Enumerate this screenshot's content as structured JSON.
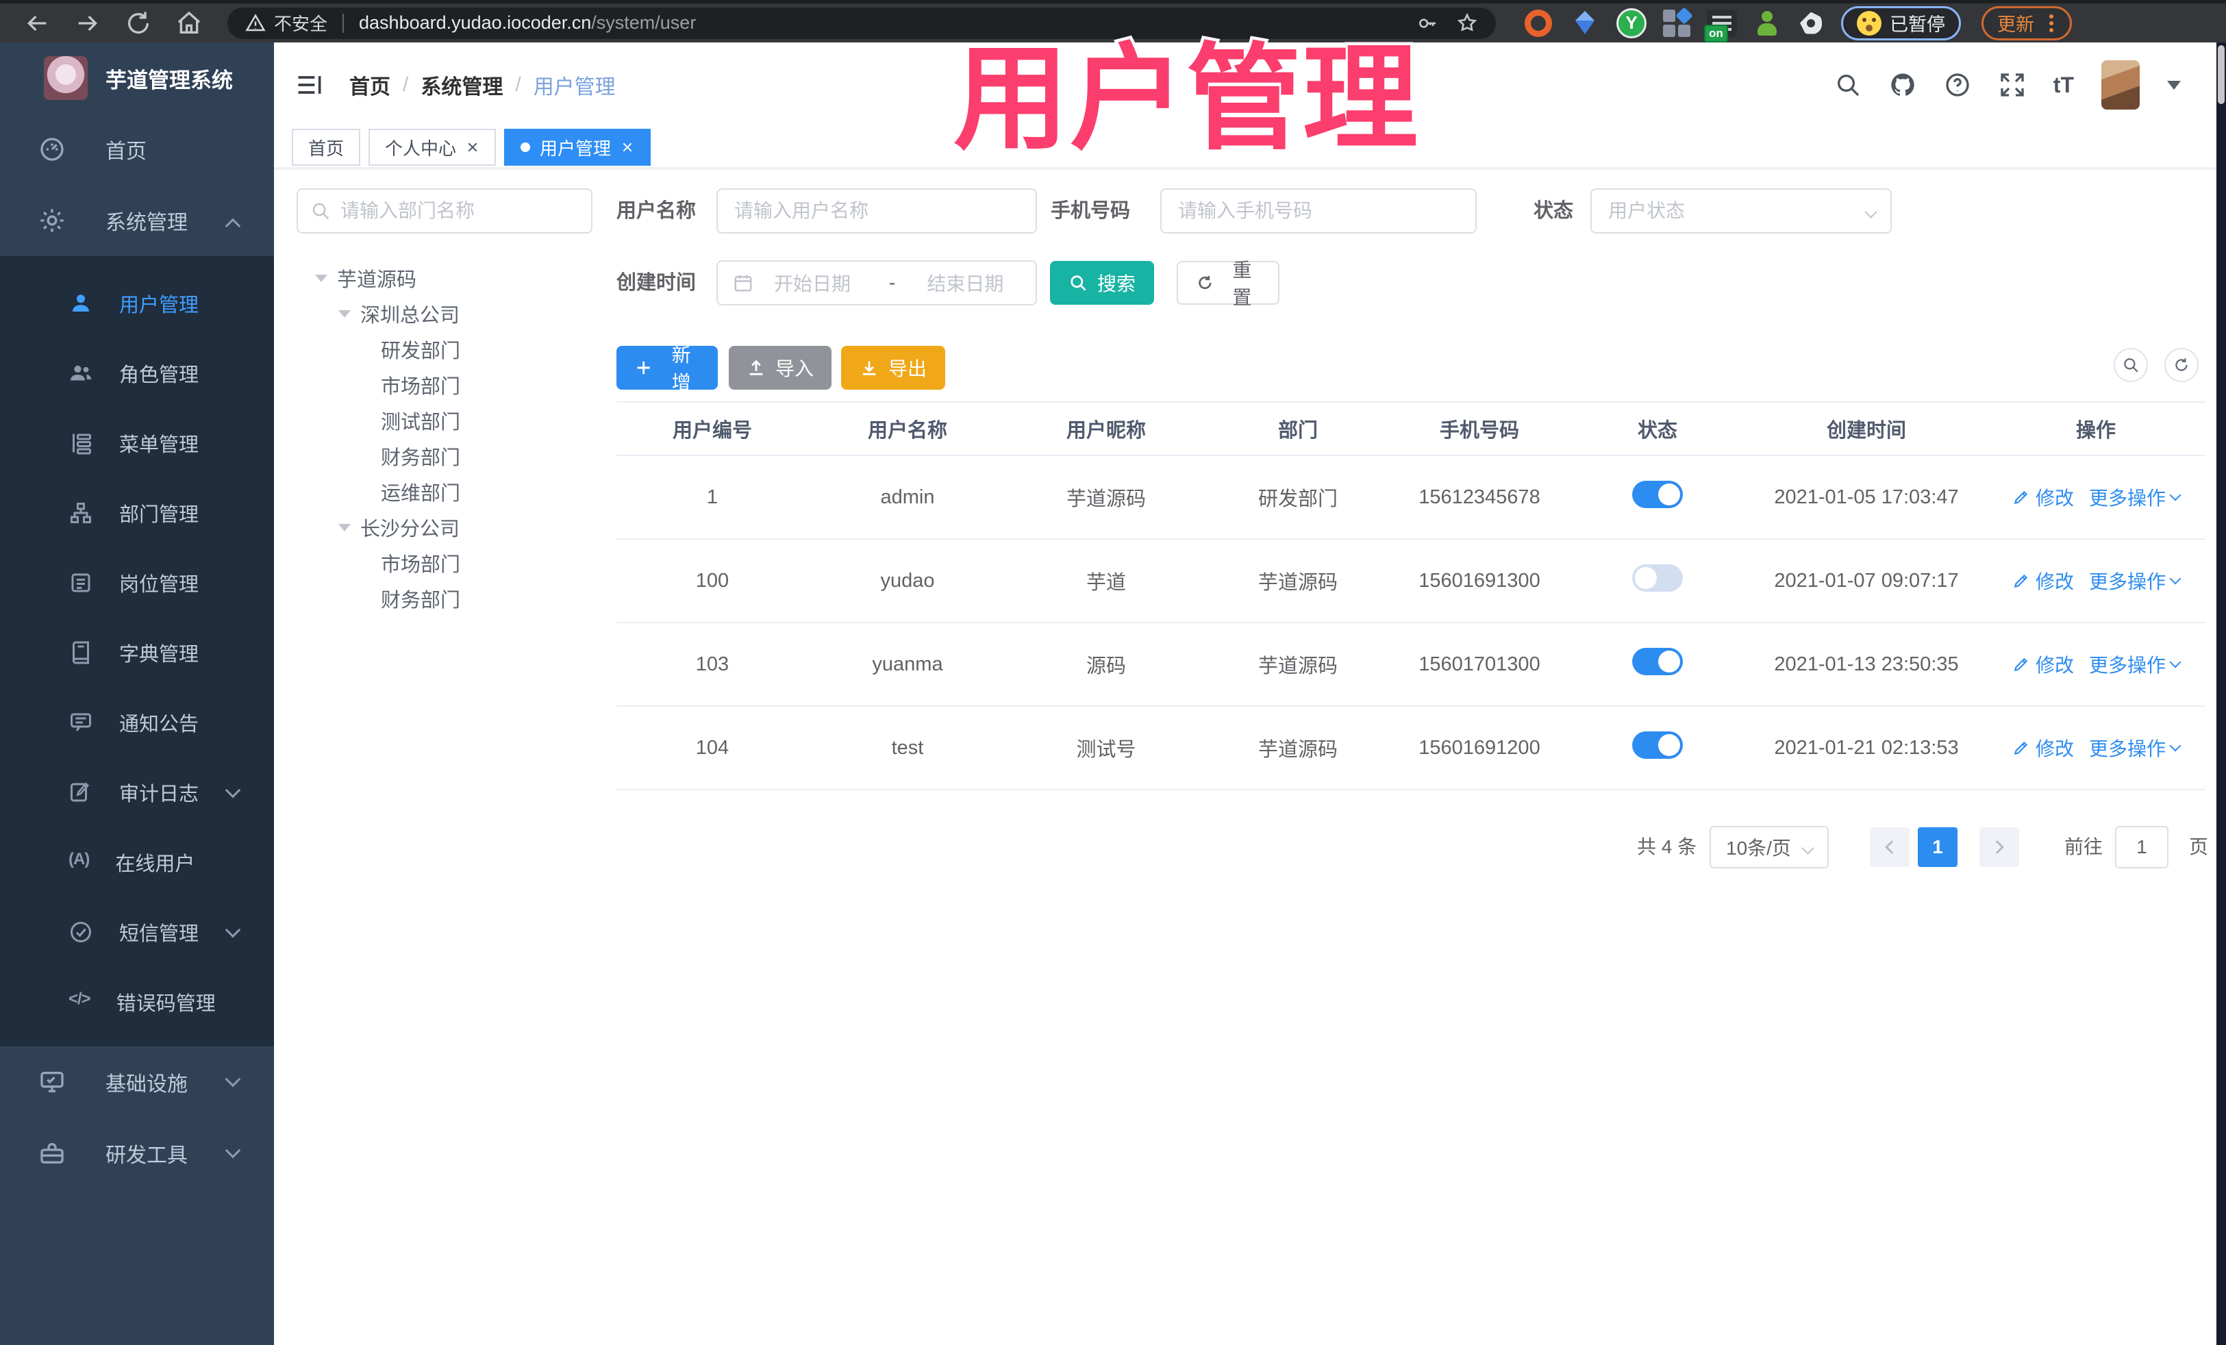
{
  "browser": {
    "security_label": "不安全",
    "url_host": "dashboard.yudao.iocoder.cn",
    "url_path": "/system/user",
    "paused_badge_label": "已暂停",
    "update_button_label": "更新",
    "extension_on_badge": "on",
    "extension_y_label": "Y"
  },
  "overlay": {
    "title": "用户管理",
    "color": "#fb3e6d"
  },
  "sidebar": {
    "logo_title": "芋道管理系统",
    "top_items": [
      {
        "label": "首页",
        "icon": "dashboard-icon"
      },
      {
        "label": "系统管理",
        "icon": "gear-icon",
        "state": "expanded"
      }
    ],
    "submenu_items": [
      {
        "label": "用户管理",
        "icon": "user-icon",
        "active": true
      },
      {
        "label": "角色管理",
        "icon": "users-icon"
      },
      {
        "label": "菜单管理",
        "icon": "menu-tree-icon"
      },
      {
        "label": "部门管理",
        "icon": "org-icon"
      },
      {
        "label": "岗位管理",
        "icon": "post-icon"
      },
      {
        "label": "字典管理",
        "icon": "dict-icon"
      },
      {
        "label": "通知公告",
        "icon": "notice-icon"
      },
      {
        "label": "审计日志",
        "icon": "audit-icon",
        "expandable": true
      },
      {
        "label": "在线用户",
        "icon": "online-icon",
        "icon_text": "(A)"
      },
      {
        "label": "短信管理",
        "icon": "sms-icon",
        "expandable": true
      },
      {
        "label": "错误码管理",
        "icon": "code-icon",
        "icon_text": "</>"
      }
    ],
    "bottom_items": [
      {
        "label": "基础设施",
        "icon": "infra-icon",
        "expandable": true
      },
      {
        "label": "研发工具",
        "icon": "tools-icon",
        "expandable": true
      }
    ]
  },
  "header": {
    "breadcrumb": {
      "items": [
        "首页",
        "系统管理",
        "用户管理"
      ],
      "separator": "/"
    },
    "fontsize_icon_text": "tT"
  },
  "tabs": [
    {
      "label": "首页",
      "closable": false,
      "active": false
    },
    {
      "label": "个人中心",
      "closable": true,
      "active": false
    },
    {
      "label": "用户管理",
      "closable": true,
      "active": true
    }
  ],
  "tree": {
    "search_placeholder": "请输入部门名称",
    "nodes": [
      {
        "label": "芋道源码",
        "level": 1,
        "expanded": true
      },
      {
        "label": "深圳总公司",
        "level": 2,
        "expanded": true
      },
      {
        "label": "研发部门",
        "level": 3
      },
      {
        "label": "市场部门",
        "level": 3
      },
      {
        "label": "测试部门",
        "level": 3
      },
      {
        "label": "财务部门",
        "level": 3
      },
      {
        "label": "运维部门",
        "level": 3
      },
      {
        "label": "长沙分公司",
        "level": 2,
        "expanded": true
      },
      {
        "label": "市场部门",
        "level": 3
      },
      {
        "label": "财务部门",
        "level": 3
      }
    ]
  },
  "filters": {
    "username_label": "用户名称",
    "username_placeholder": "请输入用户名称",
    "mobile_label": "手机号码",
    "mobile_placeholder": "请输入手机号码",
    "status_label": "状态",
    "status_placeholder": "用户状态",
    "create_time_label": "创建时间",
    "date_start_placeholder": "开始日期",
    "date_range_separator": "-",
    "date_end_placeholder": "结束日期",
    "search_button_label": "搜索",
    "reset_button_label": "重置"
  },
  "toolbar": {
    "add_button_label": "新增",
    "import_button_label": "导入",
    "export_button_label": "导出"
  },
  "table": {
    "columns": [
      "用户编号",
      "用户名称",
      "用户昵称",
      "部门",
      "手机号码",
      "状态",
      "创建时间",
      "操作"
    ],
    "action_edit_label": "修改",
    "action_more_label": "更多操作",
    "rows": [
      {
        "id": "1",
        "username": "admin",
        "nickname": "芋道源码",
        "dept": "研发部门",
        "mobile": "15612345678",
        "status_on": true,
        "created": "2021-01-05 17:03:47"
      },
      {
        "id": "100",
        "username": "yudao",
        "nickname": "芋道",
        "dept": "芋道源码",
        "mobile": "15601691300",
        "status_on": false,
        "created": "2021-01-07 09:07:17"
      },
      {
        "id": "103",
        "username": "yuanma",
        "nickname": "源码",
        "dept": "芋道源码",
        "mobile": "15601701300",
        "status_on": true,
        "created": "2021-01-13 23:50:35"
      },
      {
        "id": "104",
        "username": "test",
        "nickname": "测试号",
        "dept": "芋道源码",
        "mobile": "15601691200",
        "status_on": true,
        "created": "2021-01-21 02:13:53"
      }
    ]
  },
  "pagination": {
    "total_label": "共 4 条",
    "page_size_label": "10条/页",
    "current_page": "1",
    "goto_label": "前往",
    "goto_value": "1",
    "page_unit_label": "页"
  },
  "colors": {
    "primary": "#2d8cf0",
    "sidebar_bg": "#304156",
    "sidebar_submenu_bg": "#1f2d3d",
    "active_link": "#409eff",
    "search_button": "#17b3a3",
    "import_button": "#909399",
    "export_button": "#f0a818",
    "toggle_on": "#2d8cf0",
    "toggle_off": "#d3dff0",
    "overlay_pink": "#fb3e6d"
  }
}
